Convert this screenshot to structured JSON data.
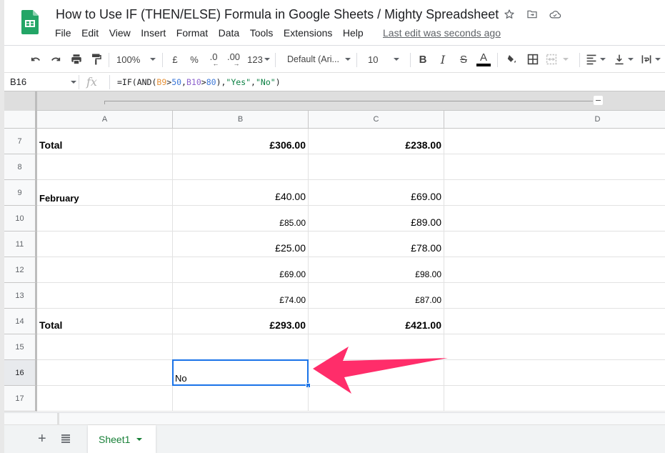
{
  "app": {
    "document_title": "How to Use IF (THEN/ELSE) Formula in Google Sheets / Mighty Spreadsheet",
    "title_icons": [
      "star-icon",
      "move-to-folder-icon",
      "cloud-saved-icon"
    ],
    "last_edit": "Last edit was seconds ago"
  },
  "menu": [
    "File",
    "Edit",
    "View",
    "Insert",
    "Format",
    "Data",
    "Tools",
    "Extensions",
    "Help"
  ],
  "toolbar": {
    "zoom": "100%",
    "currency": "£",
    "percent": "%",
    "decrease_decimals": ".0",
    "increase_decimals": ".00",
    "more_formats": "123",
    "font": "Default (Ari...",
    "font_size": "10",
    "bold": "B",
    "italic": "I",
    "strikethrough": "S",
    "text_color": "A",
    "text_color_value": "#000000"
  },
  "formula_bar": {
    "name_box": "B16",
    "fx": "fx",
    "formula_parts": [
      {
        "text": "=IF(AND(",
        "color": "default"
      },
      {
        "text": "B9",
        "color": "orange"
      },
      {
        "text": ">",
        "color": "default"
      },
      {
        "text": "50",
        "color": "blue"
      },
      {
        "text": ",",
        "color": "default"
      },
      {
        "text": "B10",
        "color": "purple"
      },
      {
        "text": ">",
        "color": "default"
      },
      {
        "text": "80",
        "color": "blue"
      },
      {
        "text": "),",
        "color": "default"
      },
      {
        "text": "\"Yes\"",
        "color": "green"
      },
      {
        "text": ",",
        "color": "default"
      },
      {
        "text": "\"No\"",
        "color": "green"
      },
      {
        "text": ")",
        "color": "default"
      }
    ]
  },
  "grid": {
    "columns": [
      "A",
      "B",
      "C",
      "D"
    ],
    "rows": [
      {
        "num": "7",
        "A": "Total",
        "B": "£306.00",
        "C": "£238.00",
        "bold": true
      },
      {
        "num": "8",
        "A": "",
        "B": "",
        "C": ""
      },
      {
        "num": "9",
        "A": "February",
        "B": "£40.00",
        "C": "£69.00",
        "a_bold": true
      },
      {
        "num": "10",
        "A": "",
        "B": "£85.00",
        "C": "£89.00"
      },
      {
        "num": "11",
        "A": "",
        "B": "£25.00",
        "C": "£78.00"
      },
      {
        "num": "12",
        "A": "",
        "B": "£69.00",
        "C": "£98.00"
      },
      {
        "num": "13",
        "A": "",
        "B": "£74.00",
        "C": "£87.00"
      },
      {
        "num": "14",
        "A": "Total",
        "B": "£293.00",
        "C": "£421.00",
        "bold": true
      },
      {
        "num": "15",
        "A": "",
        "B": "",
        "C": ""
      },
      {
        "num": "16",
        "A": "",
        "B": "No",
        "C": ""
      },
      {
        "num": "17",
        "A": "",
        "B": "",
        "C": ""
      }
    ],
    "selected_cell": "B16",
    "selection_color": "#1a73e8"
  },
  "sheets": {
    "active": "Sheet1",
    "tab_color": "#188038"
  },
  "annotation": {
    "type": "arrow",
    "color": "#ff2d6a",
    "points_to": "B16"
  }
}
